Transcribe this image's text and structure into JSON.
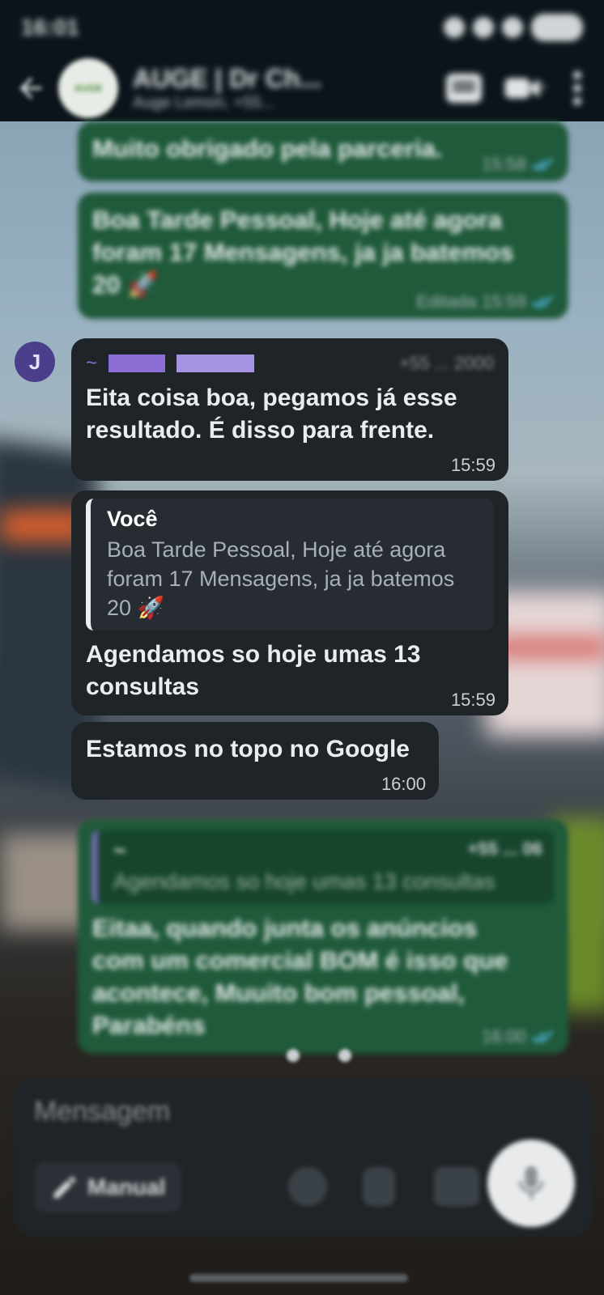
{
  "status_bar": {
    "time": "16:01"
  },
  "header": {
    "title": "AUGE | Dr Ch...",
    "subtitle": "Auge Lemon, +55...",
    "avatar_text": "AUGE"
  },
  "messages": [
    {
      "text": "Muito obrigado pela parceria.",
      "time": "15:58"
    },
    {
      "text": "Boa Tarde Pessoal, Hoje até agora foram 17 Mensagens, ja ja batemos 20 🚀",
      "time": "Editada 15:59"
    },
    {
      "sender_initial": "J",
      "sender_name": "~",
      "sender_phone": "+55 ... 2000",
      "text": "Eita coisa boa,  pegamos já esse resultado.  É disso para frente.",
      "time": "15:59"
    },
    {
      "quote_author": "Você",
      "quote_text": "Boa Tarde Pessoal, Hoje até agora foram 17 Mensagens, ja ja batemos 20 🚀",
      "text": "Agendamos so hoje umas 13 consultas",
      "time": "15:59"
    },
    {
      "text": "Estamos no topo no Google",
      "time": "16:00"
    },
    {
      "quote_author": "~",
      "quote_phone": "+55 ... 06",
      "quote_text": "Agendamos so hoje umas 13 consultas",
      "text": "Eitaa, quando junta os anúncios com um comercial BOM é isso que acontece, Muuito bom pessoal, Parabéns",
      "time": "16:00"
    }
  ],
  "composer": {
    "placeholder": "Mensagem",
    "manual_label": "Manual"
  },
  "colors": {
    "outgoing_bubble": "#1f5a3a",
    "incoming_bubble": "#1f2428",
    "read_check": "#53bdeb"
  }
}
